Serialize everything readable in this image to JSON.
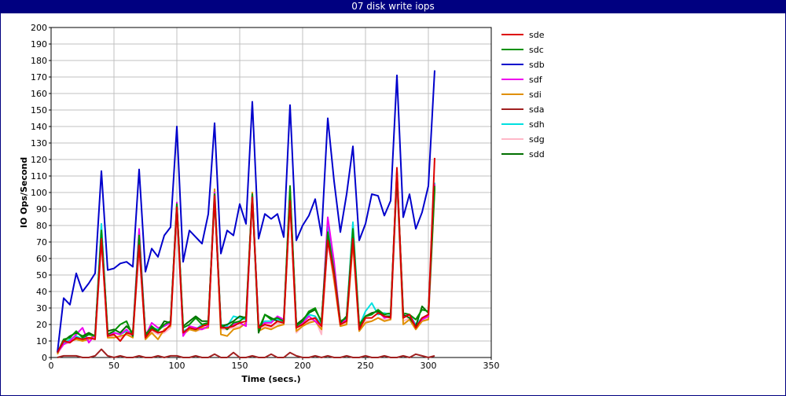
{
  "window": {
    "title": "07 disk write iops"
  },
  "chart_data": {
    "type": "line",
    "title": "07 disk write iops",
    "xlabel": "Time (secs.)",
    "ylabel": "IO Ops/Second",
    "xlim": [
      0,
      350
    ],
    "ylim": [
      0,
      200
    ],
    "xticks": [
      0,
      50,
      100,
      150,
      200,
      250,
      300,
      350
    ],
    "yticks": [
      0,
      10,
      20,
      30,
      40,
      50,
      60,
      70,
      80,
      90,
      100,
      110,
      120,
      130,
      140,
      150,
      160,
      170,
      180,
      190,
      200
    ],
    "grid": true,
    "legend_position": "right",
    "x": [
      5,
      10,
      15,
      20,
      25,
      30,
      35,
      40,
      45,
      50,
      55,
      60,
      65,
      70,
      75,
      80,
      85,
      90,
      95,
      100,
      105,
      110,
      115,
      120,
      125,
      130,
      135,
      140,
      145,
      150,
      155,
      160,
      165,
      170,
      175,
      180,
      185,
      190,
      195,
      200,
      205,
      210,
      215,
      220,
      225,
      230,
      235,
      240,
      245,
      250,
      255,
      260,
      265,
      270,
      275,
      280,
      285,
      290,
      295,
      300,
      305
    ],
    "series": [
      {
        "name": "sde",
        "color": "#dd0000",
        "values": [
          3,
          10,
          9,
          12,
          11,
          12,
          11,
          72,
          13,
          14,
          10,
          15,
          14,
          68,
          12,
          17,
          15,
          16,
          20,
          91,
          15,
          18,
          17,
          19,
          20,
          98,
          18,
          18,
          19,
          21,
          22,
          97,
          18,
          20,
          19,
          22,
          21,
          95,
          18,
          20,
          23,
          24,
          19,
          71,
          50,
          20,
          22,
          72,
          17,
          24,
          24,
          27,
          25,
          24,
          115,
          24,
          26,
          18,
          24,
          26,
          121
        ]
      },
      {
        "name": "sdc",
        "color": "#009000",
        "values": [
          3,
          11,
          12,
          16,
          12,
          14,
          13,
          77,
          14,
          16,
          20,
          22,
          13,
          74,
          13,
          19,
          16,
          20,
          22,
          93,
          18,
          20,
          24,
          20,
          21,
          99,
          20,
          17,
          21,
          22,
          25,
          99,
          17,
          26,
          23,
          24,
          22,
          104,
          19,
          22,
          28,
          30,
          21,
          76,
          52,
          22,
          24,
          78,
          20,
          25,
          26,
          29,
          26,
          27,
          113,
          27,
          26,
          23,
          29,
          28,
          104
        ]
      },
      {
        "name": "sdb",
        "color": "#0000cc",
        "values": [
          3,
          36,
          32,
          51,
          40,
          45,
          51,
          113,
          53,
          54,
          57,
          58,
          55,
          114,
          52,
          66,
          61,
          74,
          79,
          140,
          58,
          77,
          73,
          69,
          87,
          142,
          63,
          77,
          74,
          93,
          81,
          155,
          72,
          87,
          84,
          87,
          73,
          153,
          71,
          80,
          86,
          96,
          74,
          145,
          107,
          76,
          99,
          128,
          71,
          81,
          99,
          98,
          86,
          95,
          171,
          85,
          99,
          78,
          88,
          104,
          174
        ]
      },
      {
        "name": "sdf",
        "color": "#ee00ee",
        "values": [
          3,
          8,
          10,
          14,
          18,
          9,
          14,
          75,
          13,
          15,
          14,
          17,
          13,
          78,
          13,
          21,
          18,
          19,
          21,
          94,
          13,
          19,
          18,
          17,
          19,
          100,
          19,
          18,
          20,
          21,
          19,
          99,
          18,
          21,
          21,
          25,
          23,
          99,
          18,
          21,
          25,
          22,
          19,
          85,
          58,
          21,
          23,
          76,
          18,
          25,
          27,
          28,
          24,
          25,
          110,
          25,
          26,
          19,
          23,
          25,
          105
        ]
      },
      {
        "name": "sdi",
        "color": "#e09000",
        "values": [
          2,
          11,
          10,
          11,
          10,
          11,
          14,
          73,
          12,
          12,
          13,
          14,
          12,
          70,
          11,
          15,
          11,
          17,
          19,
          91,
          14,
          17,
          16,
          18,
          18,
          102,
          14,
          13,
          17,
          18,
          21,
          100,
          16,
          18,
          17,
          19,
          20,
          96,
          16,
          19,
          21,
          22,
          17,
          73,
          47,
          19,
          20,
          70,
          16,
          21,
          22,
          24,
          22,
          23,
          109,
          20,
          23,
          17,
          22,
          23,
          102
        ]
      },
      {
        "name": "sda",
        "color": "#a02020",
        "values": [
          0,
          1,
          1,
          1,
          0,
          0,
          1,
          5,
          1,
          0,
          1,
          0,
          0,
          1,
          0,
          0,
          1,
          0,
          1,
          1,
          0,
          0,
          1,
          0,
          0,
          2,
          0,
          0,
          3,
          0,
          0,
          1,
          0,
          0,
          2,
          0,
          0,
          3,
          1,
          0,
          0,
          1,
          0,
          1,
          0,
          0,
          1,
          0,
          0,
          1,
          0,
          0,
          1,
          0,
          0,
          1,
          0,
          2,
          1,
          0,
          1
        ]
      },
      {
        "name": "sdh",
        "color": "#00e0e0",
        "values": [
          3,
          9,
          11,
          13,
          11,
          14,
          13,
          81,
          14,
          15,
          14,
          16,
          15,
          76,
          14,
          18,
          17,
          19,
          22,
          92,
          16,
          18,
          17,
          20,
          21,
          100,
          20,
          19,
          25,
          24,
          23,
          98,
          19,
          22,
          22,
          23,
          22,
          100,
          20,
          22,
          26,
          25,
          20,
          80,
          53,
          21,
          25,
          82,
          19,
          28,
          33,
          26,
          27,
          26,
          112,
          25,
          26,
          20,
          24,
          26,
          106
        ]
      },
      {
        "name": "sdg",
        "color": "#ffb8c8",
        "values": [
          2,
          8,
          9,
          12,
          11,
          12,
          12,
          70,
          12,
          13,
          12,
          14,
          13,
          65,
          12,
          16,
          14,
          15,
          18,
          88,
          14,
          17,
          16,
          17,
          18,
          95,
          17,
          17,
          18,
          19,
          20,
          96,
          17,
          19,
          18,
          21,
          20,
          94,
          15,
          19,
          22,
          23,
          14,
          69,
          46,
          19,
          21,
          68,
          16,
          22,
          22,
          24,
          23,
          23,
          108,
          22,
          24,
          18,
          22,
          24,
          100
        ]
      },
      {
        "name": "sdd",
        "color": "#007000",
        "values": [
          3,
          10,
          13,
          15,
          13,
          15,
          13,
          76,
          16,
          17,
          15,
          19,
          15,
          72,
          14,
          18,
          16,
          22,
          21,
          92,
          19,
          22,
          25,
          22,
          22,
          97,
          19,
          20,
          22,
          25,
          24,
          97,
          15,
          26,
          24,
          22,
          21,
          101,
          20,
          23,
          27,
          29,
          22,
          75,
          51,
          21,
          25,
          75,
          19,
          25,
          27,
          28,
          25,
          25,
          112,
          26,
          24,
          19,
          31,
          27,
          103
        ]
      }
    ]
  }
}
